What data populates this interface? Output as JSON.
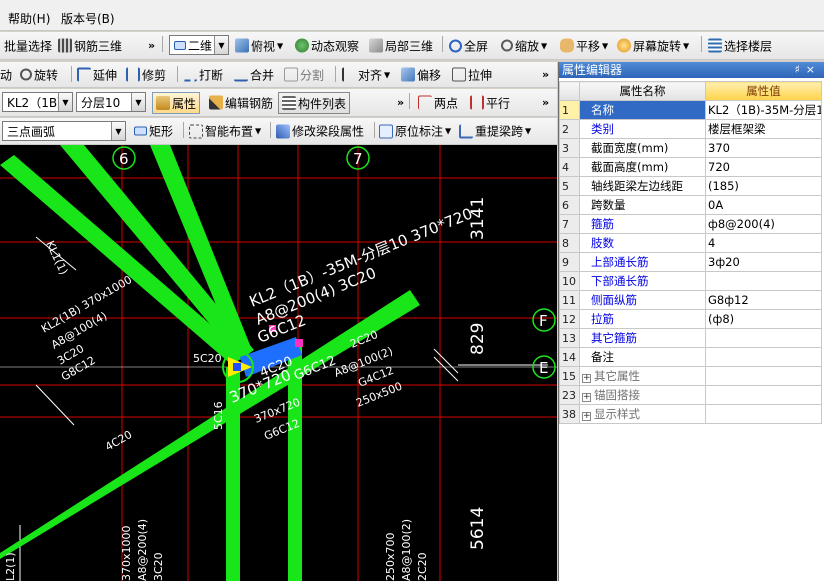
{
  "menu": {
    "help": "帮助(H)",
    "version": "版本号(B)"
  },
  "toolbar1": {
    "batch_select": "批量选择",
    "rebar_3d": "钢筋三维",
    "view_mode": "二维",
    "top_view": "俯视",
    "dynamic_observe": "动态观察",
    "local_3d": "局部三维",
    "fullscreen": "全屏",
    "zoom": "缩放",
    "pan": "平移",
    "screen_rotate": "屏幕旋转",
    "select_floor": "选择楼层"
  },
  "toolbar2": {
    "move": "动",
    "rotate": "旋转",
    "extend": "延伸",
    "trim": "修剪",
    "break": "打断",
    "merge": "合并",
    "split": "分割",
    "align": "对齐",
    "offset": "偏移",
    "stretch": "拉伸"
  },
  "toolbar3": {
    "component": "KL2（1B）",
    "layer": "分层10",
    "properties": "属性",
    "edit_rebar": "编辑钢筋",
    "component_list": "构件列表",
    "two_points": "两点",
    "parallel": "平行"
  },
  "toolbar4": {
    "draw_mode": "三点画弧",
    "rectangle": "矩形",
    "smart_layout": "智能布置",
    "modify_segment": "修改梁段属性",
    "original_label": "原位标注",
    "reextract_span": "重提梁跨"
  },
  "canvas": {
    "axis_labels": [
      "6",
      "7",
      "F",
      "E"
    ],
    "dims": [
      "3141",
      "829",
      "5614"
    ],
    "main_label_1": "KL2（1B）-35M-分层10 370*720",
    "main_label_2": "A8@200(4) 3C20",
    "main_label_3": "G6C12",
    "left_labels": [
      "KL1(1)",
      "KL2(1B) 370x1000",
      "A8@100(4)",
      "3C20",
      "G8C12",
      "4C20",
      "L2(1)"
    ],
    "center_labels": [
      "5C20",
      "2C20",
      "A8@100(2)",
      "G4C12",
      "250x500",
      "4C20",
      "G6C12",
      "370*720",
      "5C16",
      "370x720",
      "G6C12"
    ],
    "bottom_labels": [
      "370x1000",
      "A8@200(4)",
      "3C20",
      "250x700",
      "A8@100(2)",
      "2C20"
    ],
    "colors": {
      "beam": "#19e619",
      "grid": "#d40000",
      "cursor_blue": "#1f6fff",
      "axis_circle": "#19e619"
    }
  },
  "panel": {
    "title": "属性编辑器",
    "header_name": "属性名称",
    "header_value": "属性值",
    "rows": [
      {
        "num": "1",
        "name": "名称",
        "value": "KL2（1B)-35M-分层1",
        "style": "blue"
      },
      {
        "num": "2",
        "name": "类别",
        "value": "楼层框架梁",
        "style": "blue"
      },
      {
        "num": "3",
        "name": "截面宽度(mm)",
        "value": "370",
        "style": "normal"
      },
      {
        "num": "4",
        "name": "截面高度(mm)",
        "value": "720",
        "style": "normal"
      },
      {
        "num": "5",
        "name": "轴线距梁左边线距",
        "value": "(185)",
        "style": "normal"
      },
      {
        "num": "6",
        "name": "跨数量",
        "value": "0A",
        "style": "normal"
      },
      {
        "num": "7",
        "name": "箍筋",
        "value": "ф8@200(4)",
        "style": "blue"
      },
      {
        "num": "8",
        "name": "肢数",
        "value": "4",
        "style": "blue"
      },
      {
        "num": "9",
        "name": "上部通长筋",
        "value": "3ф20",
        "style": "blue"
      },
      {
        "num": "10",
        "name": "下部通长筋",
        "value": "",
        "style": "blue"
      },
      {
        "num": "11",
        "name": "侧面纵筋",
        "value": "G8ф12",
        "style": "blue"
      },
      {
        "num": "12",
        "name": "拉筋",
        "value": "(ф8)",
        "style": "blue"
      },
      {
        "num": "13",
        "name": "其它箍筋",
        "value": "",
        "style": "blue"
      },
      {
        "num": "14",
        "name": "备注",
        "value": "",
        "style": "normal"
      },
      {
        "num": "15",
        "name": "其它属性",
        "value": "",
        "style": "group"
      },
      {
        "num": "23",
        "name": "锚固搭接",
        "value": "",
        "style": "group"
      },
      {
        "num": "38",
        "name": "显示样式",
        "value": "",
        "style": "group"
      }
    ]
  }
}
